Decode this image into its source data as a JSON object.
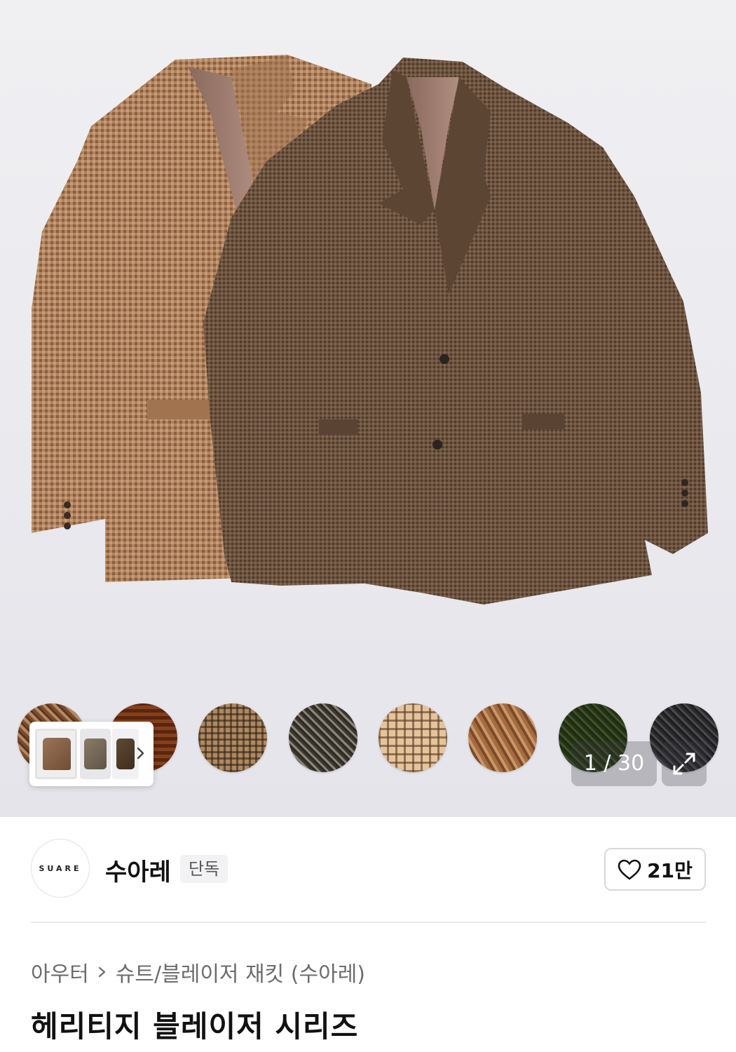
{
  "gallery": {
    "counter": "1 / 30",
    "current": 1,
    "total": 30,
    "swatches": [
      "brown-tweed",
      "tan-houndstooth",
      "tan-check",
      "charcoal-herringbone",
      "beige-glen-check",
      "brown-herringbone",
      "green-tweed",
      "black-herringbone"
    ],
    "thumbnail_count_visible": 3
  },
  "brand": {
    "logo_text": "SUARE",
    "name": "수아레",
    "badge": "단독",
    "likes": "21만"
  },
  "breadcrumb": {
    "category": "아우터",
    "subcategory": "슈트/블레이저 재킷 (수아레)"
  },
  "product": {
    "title": "헤리티지 블레이저 시리즈"
  },
  "icons": [
    "heart-icon",
    "chevron-right-icon",
    "expand-icon"
  ]
}
